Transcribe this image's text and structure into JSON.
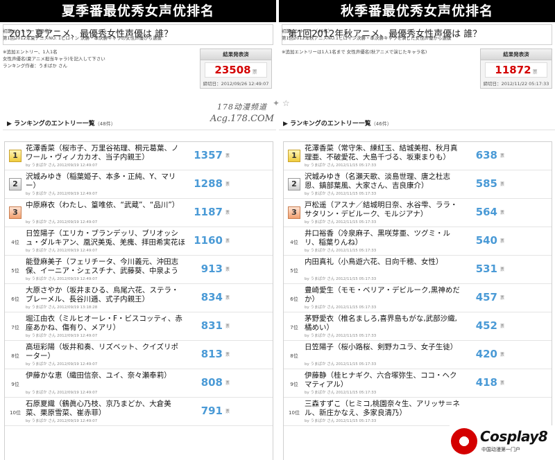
{
  "left": {
    "banner": "夏季番最优秀女声优排名",
    "question": "2012 夏アニメ、最優秀女性声優は 誰？",
    "info_lines": [
      "初期エントリー（43名）",
      "第1回2012年夏アニメNO. 1ヒロイン 決勝・準決勝キャラの女性声優から選抜",
      "",
      "※追加エントリー、1人1名",
      "女性声優名(夏アニメ担当キャラ)を記入して下さい",
      "ランキング作者：うまばか さん"
    ],
    "result_label": "結果発表済",
    "result_total": "23508",
    "vote_unit": "票",
    "result_date": "締切日：2012/09/26 12:49:07",
    "section_title": "ランキングのエントリー一覧",
    "section_count": "（48件）",
    "entries": [
      {
        "rank": "1",
        "name": "花澤香菜（桜市子、万里谷祐理、桐元葛葉、ノワール・ヴィノカカオ、当子内親王）",
        "meta": "by うまばか さん   2012/09/19 12:49:07",
        "votes": "1357"
      },
      {
        "rank": "2",
        "name": "沢城みゆき（稲葉姫子、本多・正純、Y、マリー）",
        "meta": "by うまばか さん   2012/09/19 12:49:07",
        "votes": "1288"
      },
      {
        "rank": "3",
        "name": "中原麻衣（わたし、篁唯依、“武蔵”、“品川”）",
        "meta": "by うまばか さん   2012/09/19 12:49:07",
        "votes": "1187"
      },
      {
        "rank": "4位",
        "name": "日笠陽子（エリカ・ブランデッリ、ブリオッシュ・ダルキアン、凰沢美兎、羌瘣、拝田希実花ほか）",
        "meta": "by うまばか さん   2012/09/19 12:49:07",
        "votes": "1160"
      },
      {
        "rank": "5位",
        "name": "能登麻美子（フェリチータ、今川義元、沖田志保、イーニア・シェスチナ、武藤葵、中泉ようこ）",
        "meta": "by うまばか さん   2012/09/19 12:49:07",
        "votes": "913"
      },
      {
        "rank": "6位",
        "name": "大原さやか（坂井まひる、烏尾六花、ステラ・ブレーメル、長谷川逓、式子内親王）",
        "meta": "by うまばか さん   2012/09/19 13:18:28",
        "votes": "834"
      },
      {
        "rank": "7位",
        "name": "堀江由衣（ミルヒオーレ・F・ビスコッティ、赤座あかね、傷有り、メアリ）",
        "meta": "by うまばか さん   2012/09/19 12:49:07",
        "votes": "831"
      },
      {
        "rank": "8位",
        "name": "高垣彩陽（坂井和奏、リズベット、クイズリポーター）",
        "meta": "by うまばか さん   2012/09/19 12:49:07",
        "votes": "813"
      },
      {
        "rank": "9位",
        "name": "伊藤かな恵（織田信奈、ユイ、奈々瀬奉莉）",
        "meta": "by うまばか さん   2012/09/19 12:49:07",
        "votes": "808"
      },
      {
        "rank": "10位",
        "name": "石原夏織（鶴眞心乃枝、京乃まどか、大倉美菜、栗原雪菜、崔赤菲）",
        "meta": "by うまばか さん   2012/09/19 12:49:07",
        "votes": "791"
      }
    ]
  },
  "right": {
    "banner": "秋季番最优秀女声优排名",
    "question": "第1回2012年秋アニメ、最優秀女性声優は 誰？",
    "info_lines": [
      "初期エントリー（46名）",
      "第1回2012年秋アニメNO.1ヒロイン決勝・準決勝キャラを演じた女性声優から選抜",
      "",
      "※追加エントリーは1人1名まで 女性声優名(秋アニメで演じたキャラ名)"
    ],
    "result_label": "結果発表済",
    "result_total": "11872",
    "vote_unit": "票",
    "result_date": "締切日：2012/11/22 05:17:33",
    "section_title": "ランキングのエントリー一覧",
    "section_count": "（46件）",
    "entries": [
      {
        "rank": "1",
        "name": "花澤香菜（常守朱、練紅玉、結城美柑、秋月真理亜、不破愛花、大島千づる、坂東まりも）",
        "meta": "by うまばか さん   2012/11/15 05:17:33",
        "votes": "638"
      },
      {
        "rank": "2",
        "name": "沢城みゆき（名瀬天歌、淡島世理、唐之杜志恩、鎮部葉風、大家さん、吉良康介）",
        "meta": "by うまばか さん   2012/11/15 05:17:33",
        "votes": "585"
      },
      {
        "rank": "3",
        "name": "戸松遥（アスナ／結城明日奈、水谷雫、ララ・サタリン・デビルーク、モルジアナ）",
        "meta": "by うまばか さん   2012/11/15 05:17:33",
        "votes": "564"
      },
      {
        "rank": "4位",
        "name": "井口裕香（冷泉麻子、黒咲芽亜、ツグミ・ルリ、稲葉りんね）",
        "meta": "by うまばか さん   2012/11/15 05:17:33",
        "votes": "540"
      },
      {
        "rank": "5位",
        "name": "内田真礼（小鳥遊六花、日向千穂、女性）",
        "meta": "by うまばか さん   2012/11/15 05:17:33",
        "votes": "531"
      },
      {
        "rank": "6位",
        "name": "豊崎愛生（モモ・ベリア・デビルーク,黒神めだか）",
        "meta": "by うまばか さん   2012/11/15 05:17:33",
        "votes": "457"
      },
      {
        "rank": "7位",
        "name": "茅野愛衣（椎名ましろ,喜界島もがな,武部沙織,橘めい）",
        "meta": "by うまばか さん   2012/11/15 05:17:33",
        "votes": "452"
      },
      {
        "rank": "8位",
        "name": "日笠陽子（桜小路桜、剣野カユラ、女子生徒）",
        "meta": "by うまばか さん   2012/11/15 05:17:33",
        "votes": "420"
      },
      {
        "rank": "9位",
        "name": "伊藤静（桂ヒナギク、六合塚弥生、ココ・ヘクマティアル）",
        "meta": "by うまばか さん   2012/11/15 05:17:33",
        "votes": "418"
      },
      {
        "rank": "10位",
        "name": "三森すずこ（ヒミコ,桃園奈々生、アリッサ＝ネル、新庄かなえ、多家良清乃）",
        "meta": "by うまばか さん   2012/11/15 05:17:33",
        "votes": ""
      }
    ]
  },
  "watermark": {
    "top": "178动漫频道",
    "url": "Acg.178.COM",
    "stars": "✦ ☆"
  },
  "logo": {
    "text": "Cosplay8",
    "sub": "中国动漫第一门户"
  },
  "colors": {
    "banner": "#000000",
    "total": "#d30000",
    "votes": "#4a9ad6"
  }
}
